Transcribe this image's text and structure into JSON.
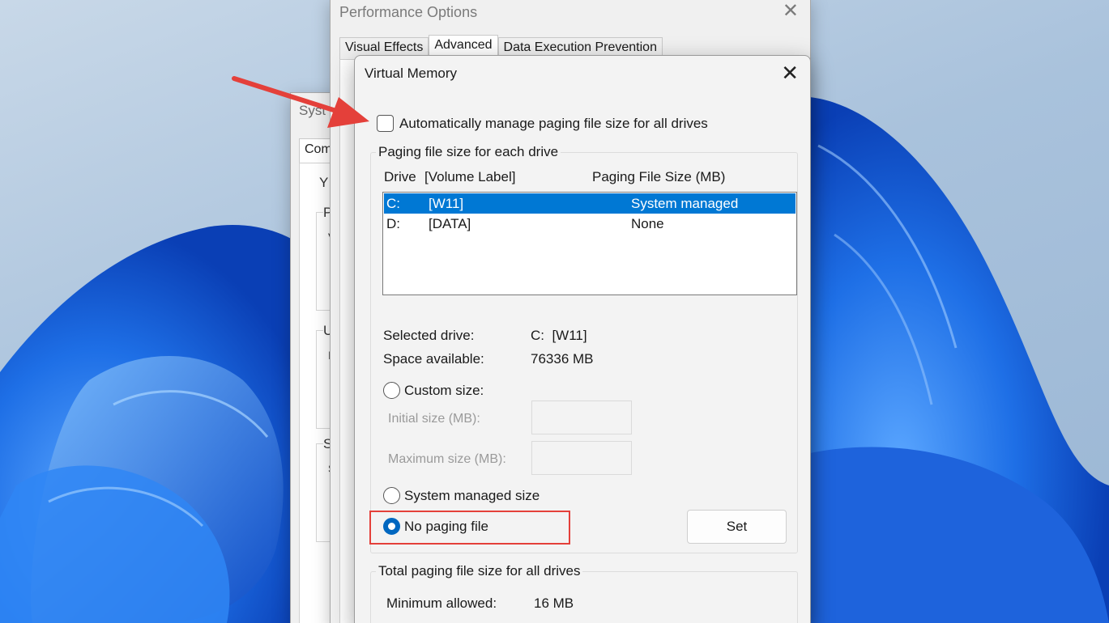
{
  "colors": {
    "accent": "#0078d4",
    "radio_on": "#0067c0",
    "annotation": "#e4403a"
  },
  "system_window": {
    "title": "Syst",
    "tab": "Com",
    "letters": [
      "Y",
      "P",
      "V",
      "U",
      "I",
      "S",
      "S"
    ]
  },
  "performance_window": {
    "title": "Performance Options",
    "close_icon": "close-icon",
    "tabs": [
      {
        "label": "Visual Effects",
        "active": false
      },
      {
        "label": "Advanced",
        "active": true
      },
      {
        "label": "Data Execution Prevention",
        "active": false
      }
    ]
  },
  "virtual_memory": {
    "title": "Virtual Memory",
    "auto_manage": {
      "label": "Automatically manage paging file size for all drives",
      "checked": false
    },
    "drives_group": {
      "legend": "Paging file size for each drive",
      "columns": [
        "Drive",
        "[Volume Label]",
        "Paging File Size (MB)"
      ],
      "rows": [
        {
          "drive": "C:",
          "label": "[W11]",
          "size": "System managed",
          "selected": true
        },
        {
          "drive": "D:",
          "label": "[DATA]",
          "size": "None",
          "selected": false
        }
      ],
      "selected_drive_label": "Selected drive:",
      "selected_drive_value": "C:  [W11]",
      "space_available_label": "Space available:",
      "space_available_value": "76336 MB",
      "custom_size": {
        "label": "Custom size:",
        "selected": false
      },
      "initial_size_label": "Initial size (MB):",
      "maximum_size_label": "Maximum size (MB):",
      "system_managed": {
        "label": "System managed size",
        "selected": false
      },
      "no_paging": {
        "label": "No paging file",
        "selected": true
      },
      "set_button": "Set"
    },
    "total_group": {
      "legend": "Total paging file size for all drives",
      "minimum_allowed_label": "Minimum allowed:",
      "minimum_allowed_value": "16 MB"
    }
  }
}
